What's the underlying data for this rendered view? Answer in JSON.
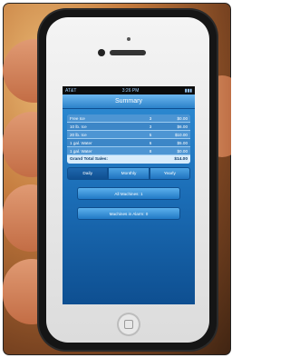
{
  "status_bar": {
    "carrier": "AT&T",
    "time": "3:26 PM",
    "battery": "battery"
  },
  "nav": {
    "title": "Summary"
  },
  "rows": [
    {
      "item": "Free Ice",
      "qty": "3",
      "amount": "$0.00"
    },
    {
      "item": "10 lb. Ice",
      "qty": "3",
      "amount": "$6.00"
    },
    {
      "item": "20 lb. Ice",
      "qty": "5",
      "amount": "$10.00"
    },
    {
      "item": "1 gal. Water",
      "qty": "6",
      "amount": "$5.00"
    },
    {
      "item": "1 gal. Water",
      "qty": "8",
      "amount": "$0.00"
    }
  ],
  "total": {
    "label": "Grand Total Sales:",
    "amount": "$14.00"
  },
  "segments": [
    {
      "label": "Daily",
      "active": true
    },
    {
      "label": "Monthly",
      "active": false
    },
    {
      "label": "Yearly",
      "active": false
    }
  ],
  "actions": {
    "all_machines": "All Machines: 1",
    "machines_in_alarm": "Machines in Alarm: 0"
  }
}
